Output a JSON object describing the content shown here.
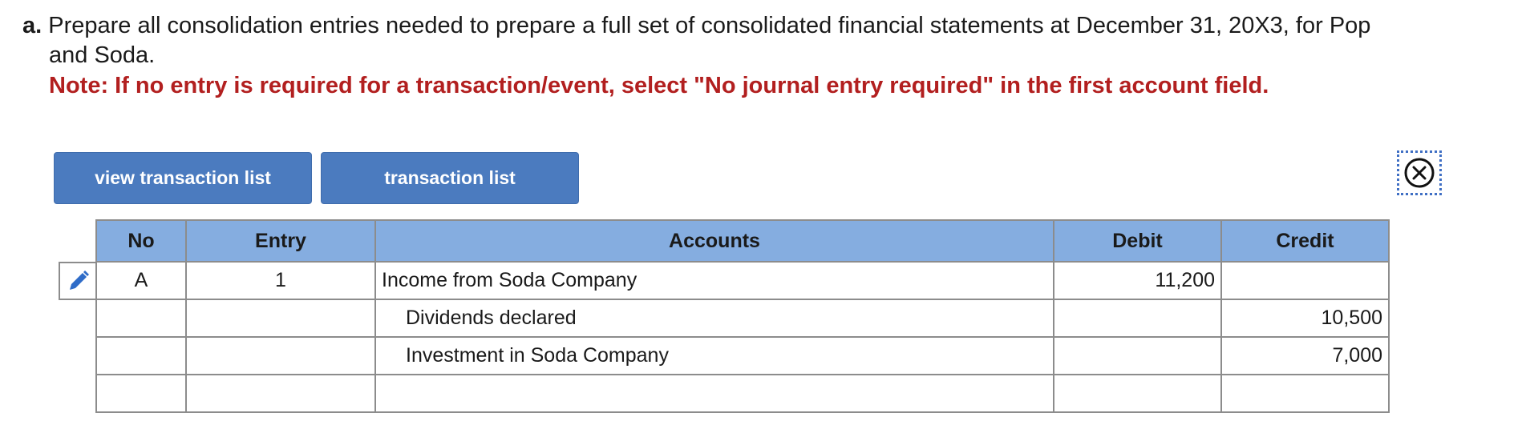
{
  "question": {
    "letter": "a.",
    "text_line1": "Prepare all consolidation entries needed to prepare a full set of consolidated financial statements at December 31, 20X3, for Pop",
    "text_line2": "and Soda.",
    "note": "Note: If no entry is required for a transaction/event, select \"No journal entry required\" in the first account field."
  },
  "buttons": {
    "view_transaction_list": "view transaction list",
    "transaction_list": "transaction list"
  },
  "icons": {
    "close": "close-circle-icon",
    "edit": "pencil-icon"
  },
  "colors": {
    "button_bg": "#4b7bbf",
    "header_bg": "#85ade0",
    "note_red": "#b21f1f",
    "focus_dots": "#3f6fc4"
  },
  "table": {
    "headers": {
      "no": "No",
      "entry": "Entry",
      "accounts": "Accounts",
      "debit": "Debit",
      "credit": "Credit"
    },
    "rows": [
      {
        "no": "A",
        "entry": "1",
        "account": "Income from Soda Company",
        "debit": "11,200",
        "credit": ""
      },
      {
        "no": "",
        "entry": "",
        "account": "Dividends declared",
        "debit": "",
        "credit": "10,500"
      },
      {
        "no": "",
        "entry": "",
        "account": "Investment in Soda Company",
        "debit": "",
        "credit": "7,000"
      },
      {
        "no": "",
        "entry": "",
        "account": "",
        "debit": "",
        "credit": ""
      }
    ]
  }
}
